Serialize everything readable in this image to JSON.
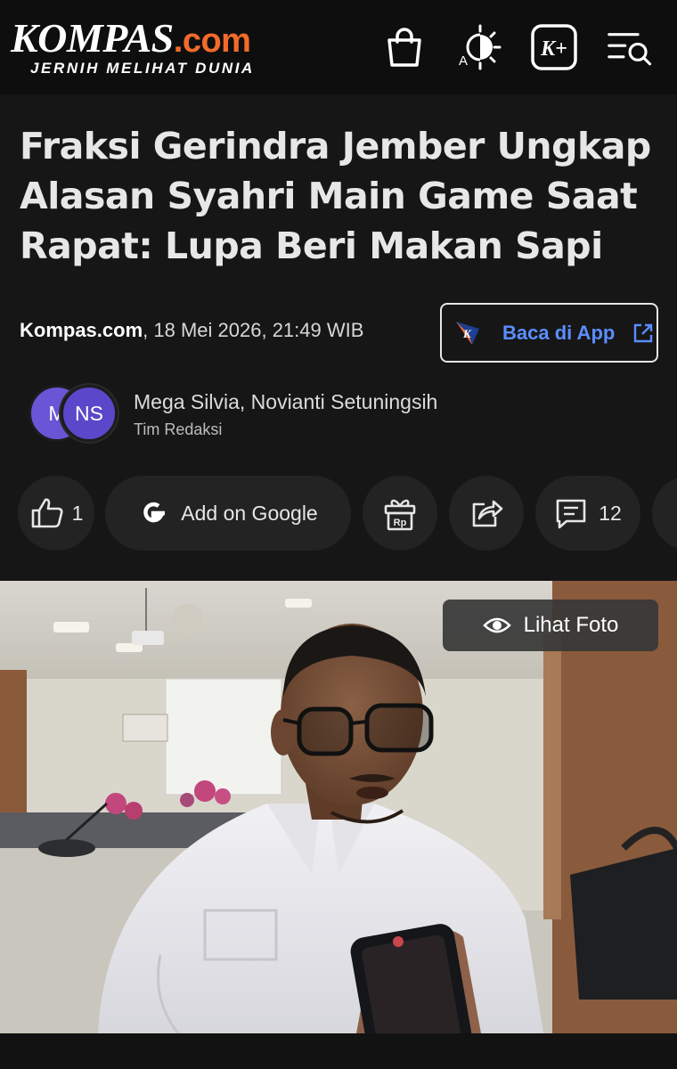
{
  "header": {
    "logo_name": "KOMPAS",
    "logo_domain": ".com",
    "tagline": "JERNIH MELIHAT DUNIA",
    "icons": [
      "shopping-bag-icon",
      "theme-toggle-icon",
      "kplus-icon",
      "menu-search-icon"
    ],
    "kplus_label": "K+",
    "theme_label": "A"
  },
  "article": {
    "headline": "Fraksi Gerindra Jember Ungkap Alasan Syahri Main Game Saat Rapat: Lupa Beri Makan Sapi",
    "source": "Kompas.com",
    "datetime": ", 18 Mei 2026, 21:49 WIB",
    "app_button_label": "Baca di App",
    "app_logo_letter": "K",
    "authors": "Mega Silvia,  Novianti Setuningsih",
    "team": "Tim Redaksi",
    "avatar_initials": [
      "M",
      "NS"
    ]
  },
  "actions": {
    "like_count": "1",
    "google_label": "Add on Google",
    "comment_count": "12",
    "gift_label": "Rp"
  },
  "photo": {
    "view_label": "Lihat Foto"
  },
  "colors": {
    "brand_orange": "#f26b2a",
    "link_blue": "#5b8dff",
    "avatar_purple": "#6a55d6"
  }
}
